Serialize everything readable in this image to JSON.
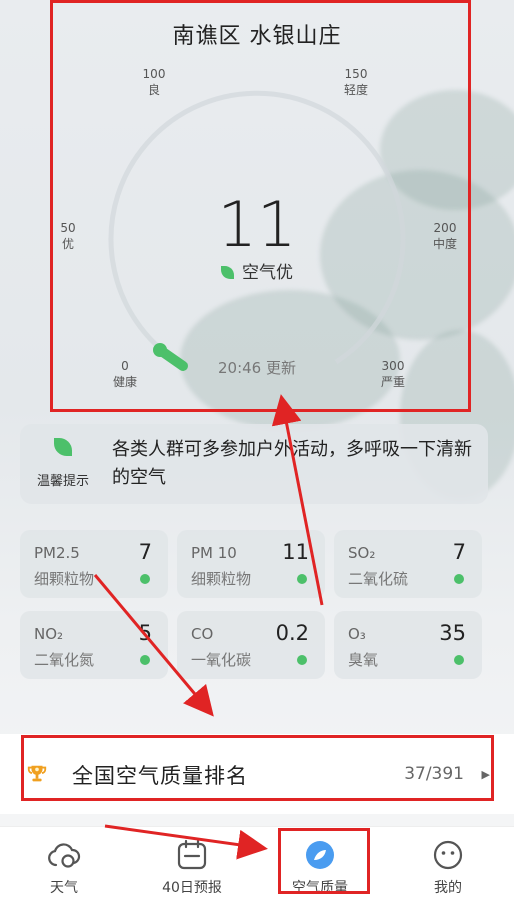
{
  "header": {
    "location": "南谯区 水银山庄",
    "aqi_value": "11",
    "aqi_level": "空气优",
    "update_time": "20:46 更新",
    "scale": [
      {
        "value": "0",
        "label": "健康"
      },
      {
        "value": "50",
        "label": "优"
      },
      {
        "value": "100",
        "label": "良"
      },
      {
        "value": "150",
        "label": "轻度"
      },
      {
        "value": "200",
        "label": "中度"
      },
      {
        "value": "300",
        "label": "严重"
      }
    ]
  },
  "tip": {
    "caption": "温馨提示",
    "text": "各类人群可多参加户外活动，多呼吸一下清新的空气"
  },
  "pollutants": [
    {
      "name": "PM2.5",
      "desc": "细颗粒物",
      "value": "7"
    },
    {
      "name": "PM 10",
      "desc": "细颗粒物",
      "value": "11"
    },
    {
      "name": "SO₂",
      "desc": "二氧化硫",
      "value": "7"
    },
    {
      "name": "NO₂",
      "desc": "二氧化氮",
      "value": "5"
    },
    {
      "name": "CO",
      "desc": "一氧化碳",
      "value": "0.2"
    },
    {
      "name": "O₃",
      "desc": "臭氧",
      "value": "35"
    }
  ],
  "ranking": {
    "title": "全国空气质量排名",
    "value": "37/391"
  },
  "nav": {
    "items": [
      {
        "label": "天气",
        "icon": "cloud-icon"
      },
      {
        "label": "40日预报",
        "icon": "calendar-icon"
      },
      {
        "label": "空气质量",
        "icon": "air-quality-icon",
        "active": true
      },
      {
        "label": "我的",
        "icon": "profile-icon"
      }
    ]
  },
  "colors": {
    "good_green": "#4cc06a",
    "annotation_red": "#e02424",
    "active_blue": "#4a9cf0"
  }
}
